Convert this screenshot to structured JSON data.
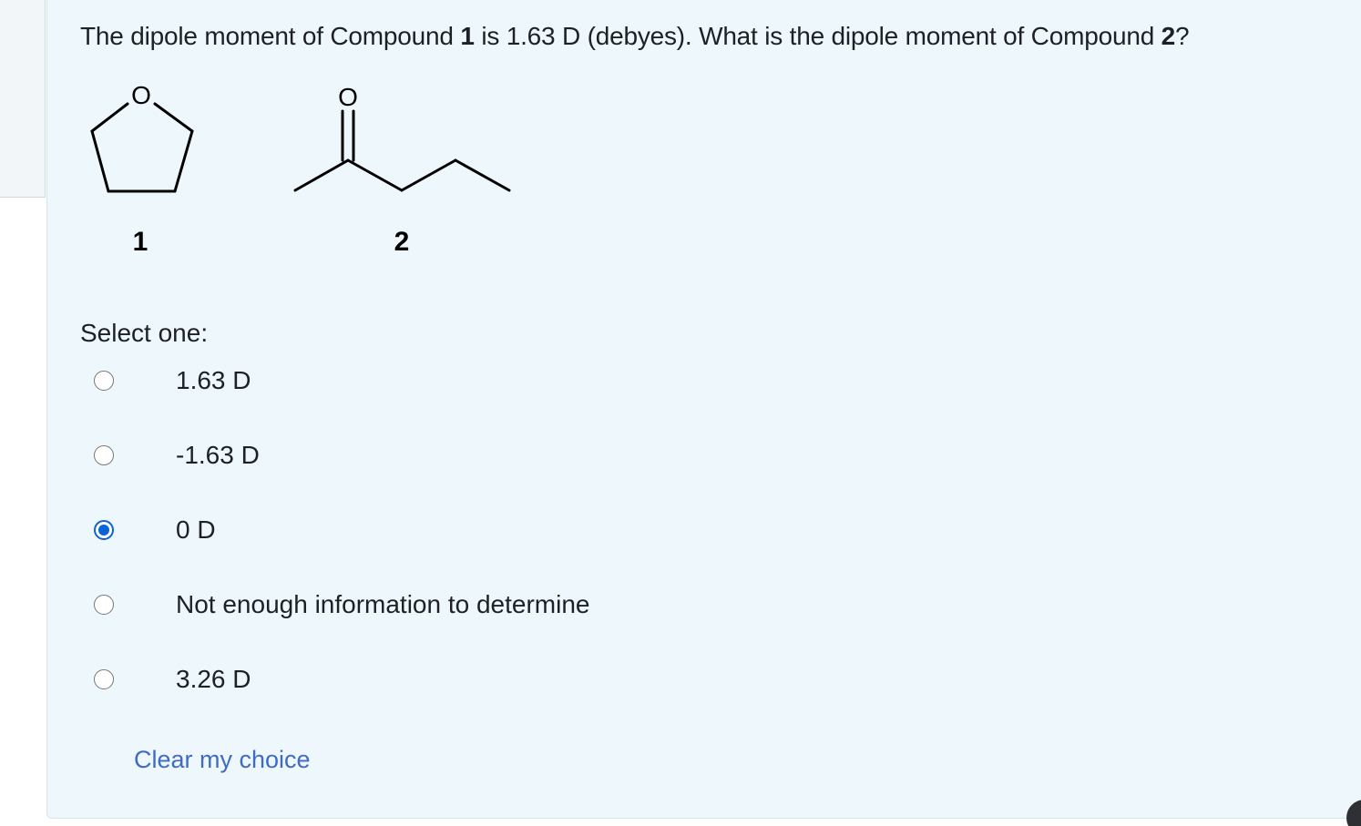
{
  "question": {
    "part1": "The dipole moment of Compound ",
    "cmpd1": "1",
    "part2": " is 1.63 D (debyes). What is the dipole moment of Compound ",
    "cmpd2": "2",
    "part3": "?"
  },
  "structures": {
    "compound1": {
      "label": "1",
      "heteroatom": "O"
    },
    "compound2": {
      "label": "2",
      "heteroatom": "O"
    }
  },
  "prompt": "Select one:",
  "options": [
    {
      "label": "1.63 D",
      "checked": false
    },
    {
      "label": "-1.63 D",
      "checked": false
    },
    {
      "label": "0 D",
      "checked": true
    },
    {
      "label": "Not enough information to determine",
      "checked": false
    },
    {
      "label": "3.26 D",
      "checked": false
    }
  ],
  "clear_link": "Clear my choice",
  "colors": {
    "accent": "#0b63d6",
    "link": "#3f6bc4",
    "panel_bg": "#eef7fb"
  }
}
